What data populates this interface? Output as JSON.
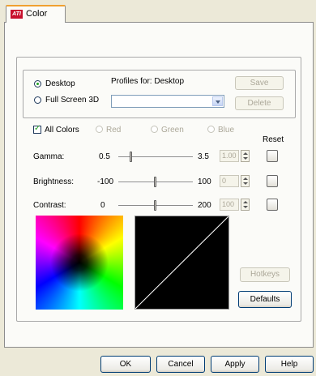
{
  "tab": {
    "label": "Color",
    "logo": "ATI"
  },
  "profiles": {
    "desktop_label": "Desktop",
    "fullscreen_label": "Full Screen 3D",
    "profiles_for": "Profiles for: Desktop",
    "combo_value": "",
    "save_label": "Save",
    "delete_label": "Delete",
    "selected": "desktop"
  },
  "channels": {
    "all_colors": "All Colors",
    "red": "Red",
    "green": "Green",
    "blue": "Blue",
    "reset_label": "Reset"
  },
  "sliders": {
    "gamma": {
      "label": "Gamma:",
      "min": "0.5",
      "max": "3.5",
      "value": "1.00",
      "fraction": 0.17
    },
    "brightness": {
      "label": "Brightness:",
      "min": "-100",
      "max": "100",
      "value": "0",
      "fraction": 0.5
    },
    "contrast": {
      "label": "Contrast:",
      "min": "0",
      "max": "200",
      "value": "100",
      "fraction": 0.5
    }
  },
  "buttons": {
    "hotkeys": "Hotkeys",
    "defaults": "Defaults",
    "ok": "OK",
    "cancel": "Cancel",
    "apply": "Apply",
    "help": "Help"
  },
  "colors": {
    "panel_bg": "#fbfbf8",
    "window_bg": "#ece9d8",
    "tab_accent": "#f0a030",
    "button_border": "#003c74"
  }
}
